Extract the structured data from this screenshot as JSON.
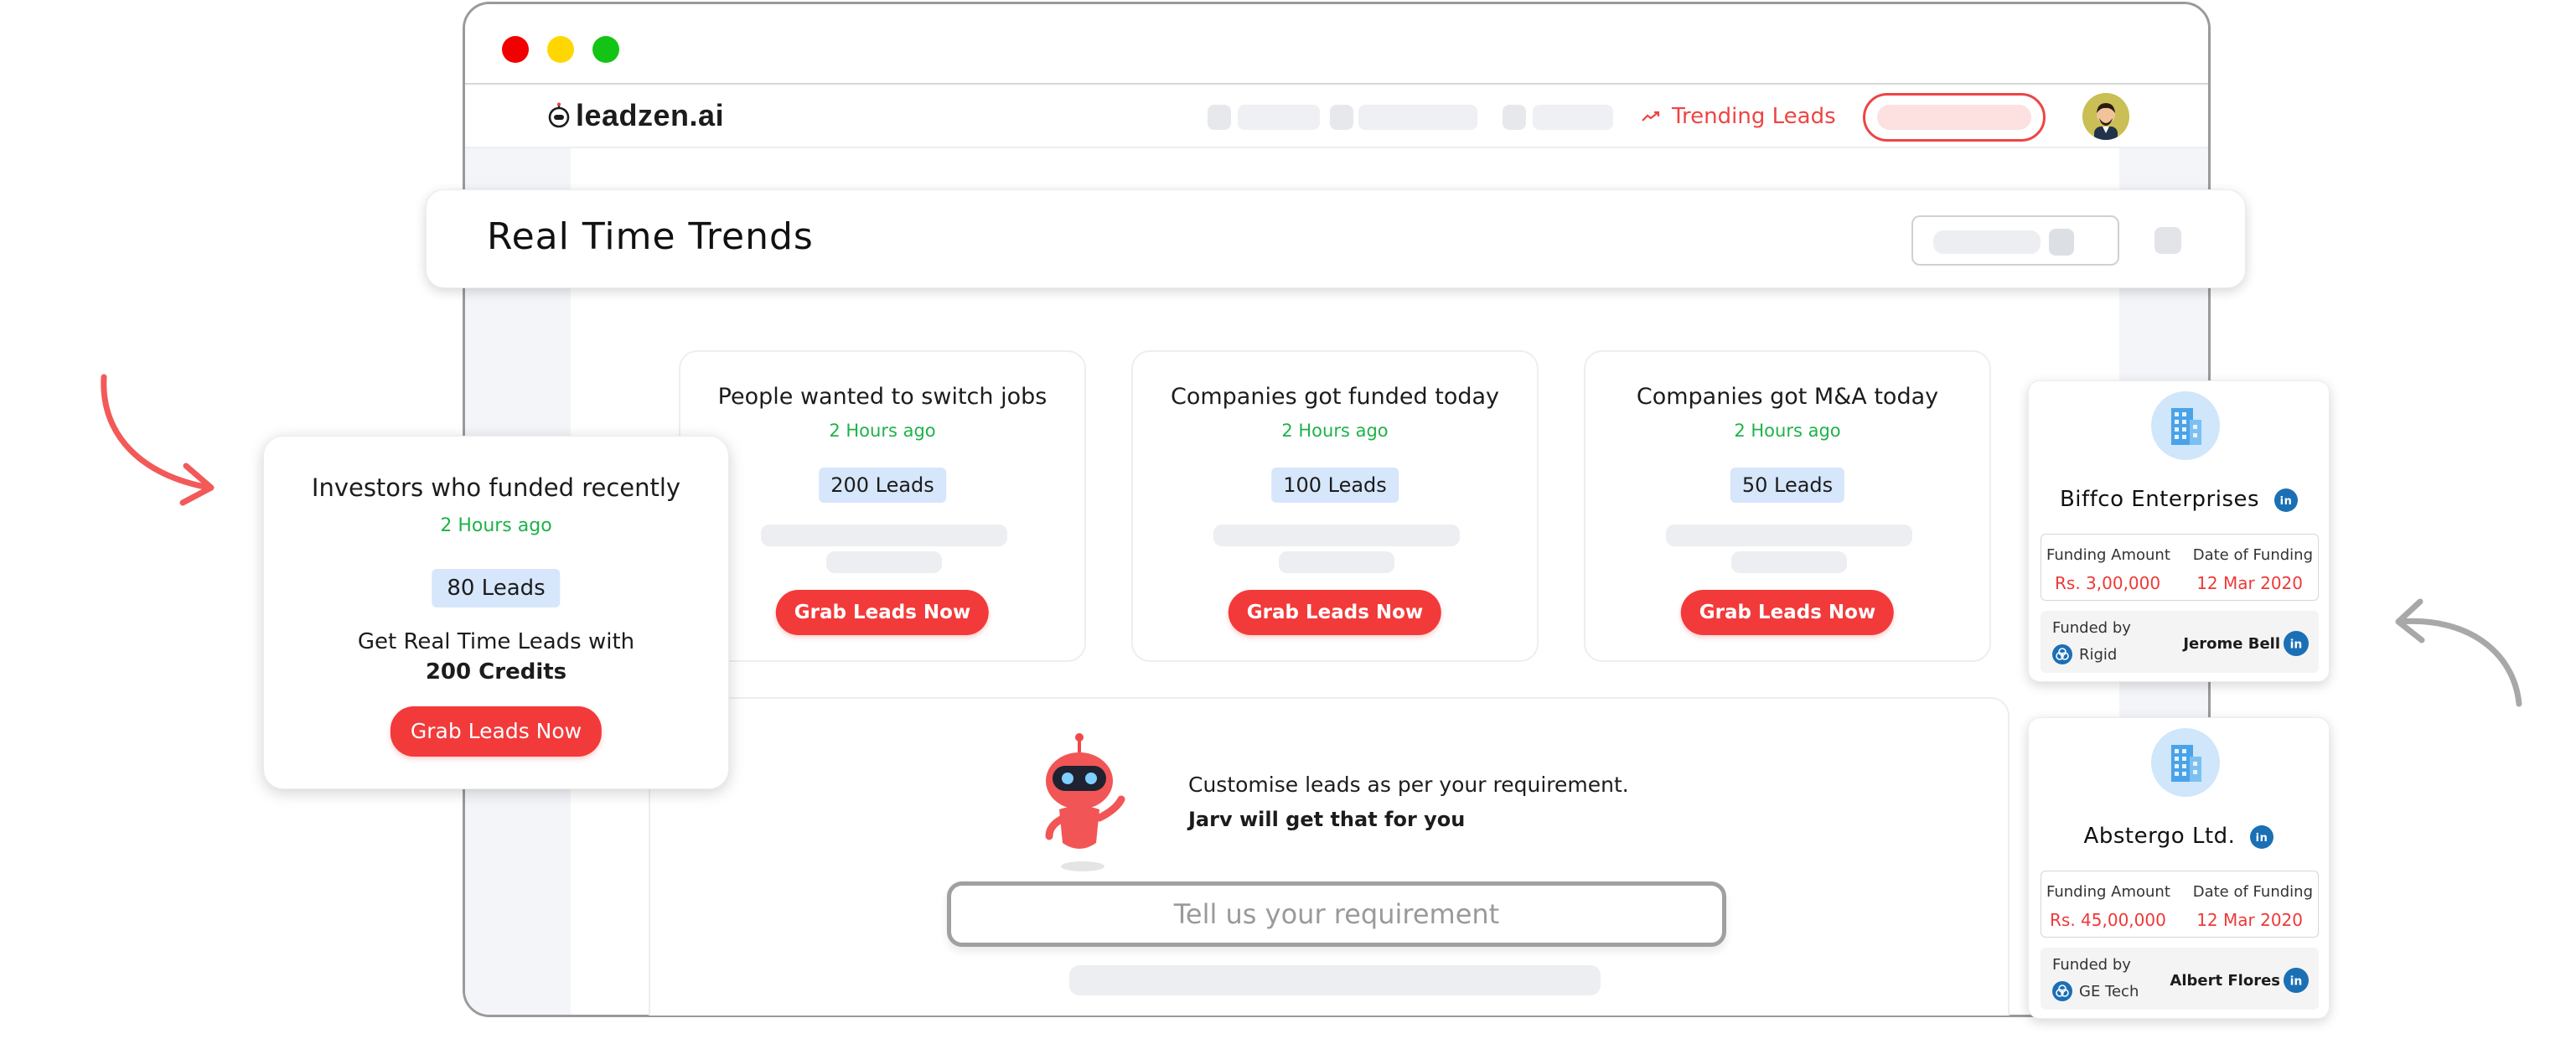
{
  "window": {
    "controls": [
      "close",
      "minimize",
      "maximize"
    ]
  },
  "navbar": {
    "logo_text": "leadzen.ai",
    "trending_link": "Trending Leads",
    "trending_icon": "trending-up-icon",
    "accent_color": "#ee4444"
  },
  "header": {
    "title": "Real Time Trends"
  },
  "trend_cards": [
    {
      "title": "People wanted to switch jobs",
      "time": "2 Hours ago",
      "leads": "200 Leads",
      "button": "Grab Leads Now"
    },
    {
      "title": "Companies got funded today",
      "time": "2 Hours ago",
      "leads": "100 Leads",
      "button": "Grab Leads Now"
    },
    {
      "title": "Companies got M&A today",
      "time": "2 Hours ago",
      "leads": "50 Leads",
      "button": "Grab Leads Now"
    }
  ],
  "investor_card": {
    "title": "Investors who funded recently",
    "time": "2 Hours ago",
    "leads": "80 Leads",
    "text": "Get Real Time Leads with",
    "credits": "200 Credits",
    "button": "Grab Leads Now"
  },
  "jarv": {
    "line1": "Customise leads as per your requirement.",
    "line2": "Jarv will get that for you",
    "input_placeholder": "Tell us your requirement"
  },
  "companies": [
    {
      "name": "Biffco Enterprises",
      "funding_amount_label": "Funding Amount",
      "funding_amount": "Rs. 3,00,000",
      "date_label": "Date of Funding",
      "date": "12 Mar 2020",
      "funded_by_label": "Funded by",
      "funded_by_org": "Rigid",
      "person": "Jerome Bell"
    },
    {
      "name": "Abstergo Ltd.",
      "funding_amount_label": "Funding Amount",
      "funding_amount": "Rs. 45,00,000",
      "date_label": "Date of Funding",
      "date": "12 Mar 2020",
      "funded_by_label": "Funded by",
      "funded_by_org": "GE Tech",
      "person": "Albert Flores"
    }
  ],
  "colors": {
    "brand_red": "#f23a3a",
    "success_green": "#1fb24a",
    "badge_blue": "#d6e6fb",
    "linkedin_blue": "#1b6fb5"
  }
}
